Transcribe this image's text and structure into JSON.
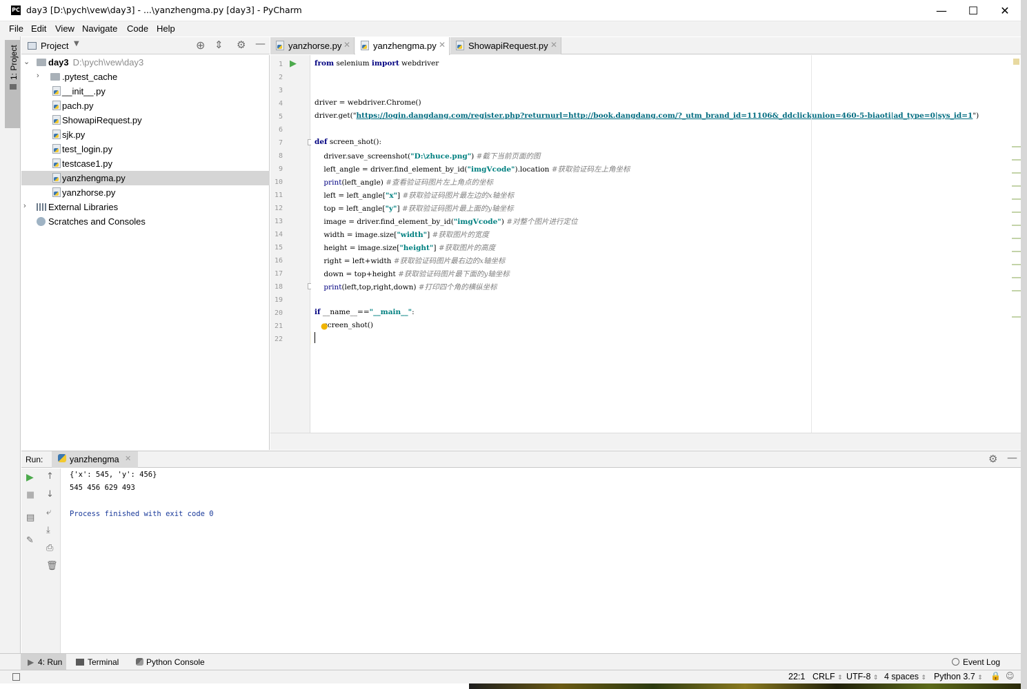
{
  "window": {
    "title": "day3 [D:\\pych\\vew\\day3] - ...\\yanzhengma.py [day3] - PyCharm",
    "app_icon_text": "PC",
    "minimize": "—",
    "maximize": "☐",
    "close": "✕"
  },
  "menu": [
    "File",
    "Edit",
    "View",
    "Navigate",
    "Code",
    "Help"
  ],
  "left_strip": {
    "project_tab": "1: Project"
  },
  "project": {
    "title": "Project",
    "root": {
      "name": "day3",
      "path": "D:\\pych\\vew\\day3"
    },
    "items": [
      {
        "label": ".pytest_cache",
        "kind": "folder"
      },
      {
        "label": "__init__.py",
        "kind": "py"
      },
      {
        "label": "pach.py",
        "kind": "py"
      },
      {
        "label": "ShowapiRequest.py",
        "kind": "py"
      },
      {
        "label": "sjk.py",
        "kind": "py"
      },
      {
        "label": "test_login.py",
        "kind": "py"
      },
      {
        "label": "testcase1.py",
        "kind": "py"
      },
      {
        "label": "yanzhengma.py",
        "kind": "py",
        "selected": true
      },
      {
        "label": "yanzhorse.py",
        "kind": "py"
      }
    ],
    "external_libraries": "External Libraries",
    "scratches": "Scratches and Consoles"
  },
  "tabs": [
    {
      "label": "yanzhorse.py",
      "active": false
    },
    {
      "label": "yanzhengma.py",
      "active": true
    },
    {
      "label": "ShowapiRequest.py",
      "active": false
    }
  ],
  "editor": {
    "line_numbers": [
      "1",
      "2",
      "3",
      "4",
      "5",
      "6",
      "7",
      "8",
      "9",
      "10",
      "11",
      "12",
      "13",
      "14",
      "15",
      "16",
      "17",
      "18",
      "19",
      "20",
      "21",
      "22"
    ],
    "code": {
      "l1_kw1": "from",
      "l1_mid": " selenium ",
      "l1_kw2": "import",
      "l1_end": " webdriver",
      "l4": "driver = webdriver.Chrome()",
      "l5_pre": "driver.get(\"",
      "l5_url": "https://login.dangdang.com/register.php?returnurl=http://book.dangdang.com/?_utm_brand_id=11106&_ddclickunion=460-5-biaoti|ad_type=0|sys_id=1",
      "l5_post": "\")",
      "l7_kw": "def",
      "l7_rest": " screen_shot():",
      "l8_pre": "    driver.save_screenshot(",
      "l8_str": "\"D:\\zhuce.png\"",
      "l8_post": ") ",
      "l8_cm": "#截下当前页面的图",
      "l9_pre": "    left_angle = driver.find_element_by_id(",
      "l9_str": "\"imgVcode\"",
      "l9_post": ").location ",
      "l9_cm": "#获取验证码左上角坐标",
      "l10_kw": "    print",
      "l10_post": "(left_angle) ",
      "l10_cm": "#查看验证码图片左上角点的坐标",
      "l11_pre": "    left = left_angle[",
      "l11_str": "\"x\"",
      "l11_post": "] ",
      "l11_cm": "#获取验证码图片最左边的x轴坐标",
      "l12_pre": "    top = left_angle[",
      "l12_str": "\"y\"",
      "l12_post": "] ",
      "l12_cm": "#获取验证码图片最上面的y轴坐标",
      "l13_pre": "    image = driver.find_element_by_id(",
      "l13_str": "\"imgVcode\"",
      "l13_post": ") ",
      "l13_cm": "#对整个图片进行定位",
      "l14_pre": "    width = image.size[",
      "l14_str": "\"width\"",
      "l14_post": "] ",
      "l14_cm": "#获取图片的宽度",
      "l15_pre": "    height = image.size[",
      "l15_str": "\"height\"",
      "l15_post": "] ",
      "l15_cm": "#获取图片的高度",
      "l16_pre": "    right = left+width ",
      "l16_cm": "#获取验证码图片最右边的x轴坐标",
      "l17_pre": "    down = top+height ",
      "l17_cm": "#获取验证码图片最下面的y轴坐标",
      "l18_kw": "    print",
      "l18_post": "(left,top,right,down) ",
      "l18_cm": "#打印四个角的横纵坐标",
      "l20_kw": "if",
      "l20_mid": " __name__==",
      "l20_str": "\"__main__\"",
      "l20_end": ":",
      "l21": "    screen_shot()"
    }
  },
  "run": {
    "label": "Run:",
    "tab": "yanzhengma",
    "output": [
      "{'x': 545, 'y': 456}",
      "545 456 629 493",
      "",
      "Process finished with exit code 0"
    ]
  },
  "bottom_tabs": [
    {
      "label": "4: Run",
      "active": true
    },
    {
      "label": "Terminal",
      "active": false
    },
    {
      "label": "Python Console",
      "active": false
    }
  ],
  "event_log": "Event Log",
  "status": {
    "position": "22:1",
    "line_sep": "CRLF",
    "encoding": "UTF-8",
    "indent": "4 spaces",
    "interpreter": "Python 3.7"
  }
}
